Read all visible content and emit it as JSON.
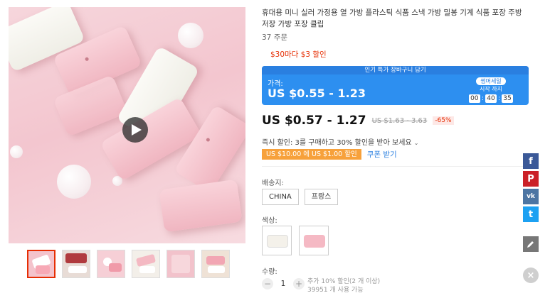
{
  "product": {
    "title": "휴대용 미니 실러 가정용 열 가방 플라스틱 식품 스낵 가방 밀봉 기계 식품 포장 주방 저장 가방 포장 클립",
    "orders": "37 주문",
    "coupon_line": "$30마다 $3 할인"
  },
  "flash_deal": {
    "banner": "인기 특가 장바구니 담기",
    "price_label": "가격:",
    "price": "US $0.55 - 1.23",
    "badge": "썸머세일",
    "until": "시작 까지",
    "timer": {
      "hours": "00",
      "minutes": "40",
      "seconds": "35"
    }
  },
  "price": {
    "current": "US $0.57 - 1.27",
    "original": "US $1.63 - 3.63",
    "discount": "-65%"
  },
  "bulk_discount": "즉시 할인: 3를 구매하고 30% 할인을 받아 보세요",
  "store_coupon": {
    "label": "US $10.00 에 US $1.00 할인",
    "get": "쿠폰 받기"
  },
  "shipping": {
    "label": "배송지:",
    "options": [
      "CHINA",
      "프랑스"
    ]
  },
  "color": {
    "label": "색상:",
    "options": [
      {
        "name": "white",
        "swatch": "#f4f1ea"
      },
      {
        "name": "pink",
        "swatch": "#f5b9c4"
      }
    ]
  },
  "quantity": {
    "label": "수량:",
    "value": "1",
    "minus": "−",
    "plus": "+",
    "note1": "추가 10% 할인(2 개 이상)",
    "note2": "39951 개 사용 가능"
  },
  "share": {
    "facebook": "f",
    "pinterest": "P",
    "vk": "vk",
    "twitter": "t",
    "close": "×"
  },
  "colors": {
    "accent_red": "#e62e04",
    "flash_blue": "#2d8ff0",
    "coupon_orange": "#f7a13b",
    "link_blue": "#2a7fe0"
  }
}
